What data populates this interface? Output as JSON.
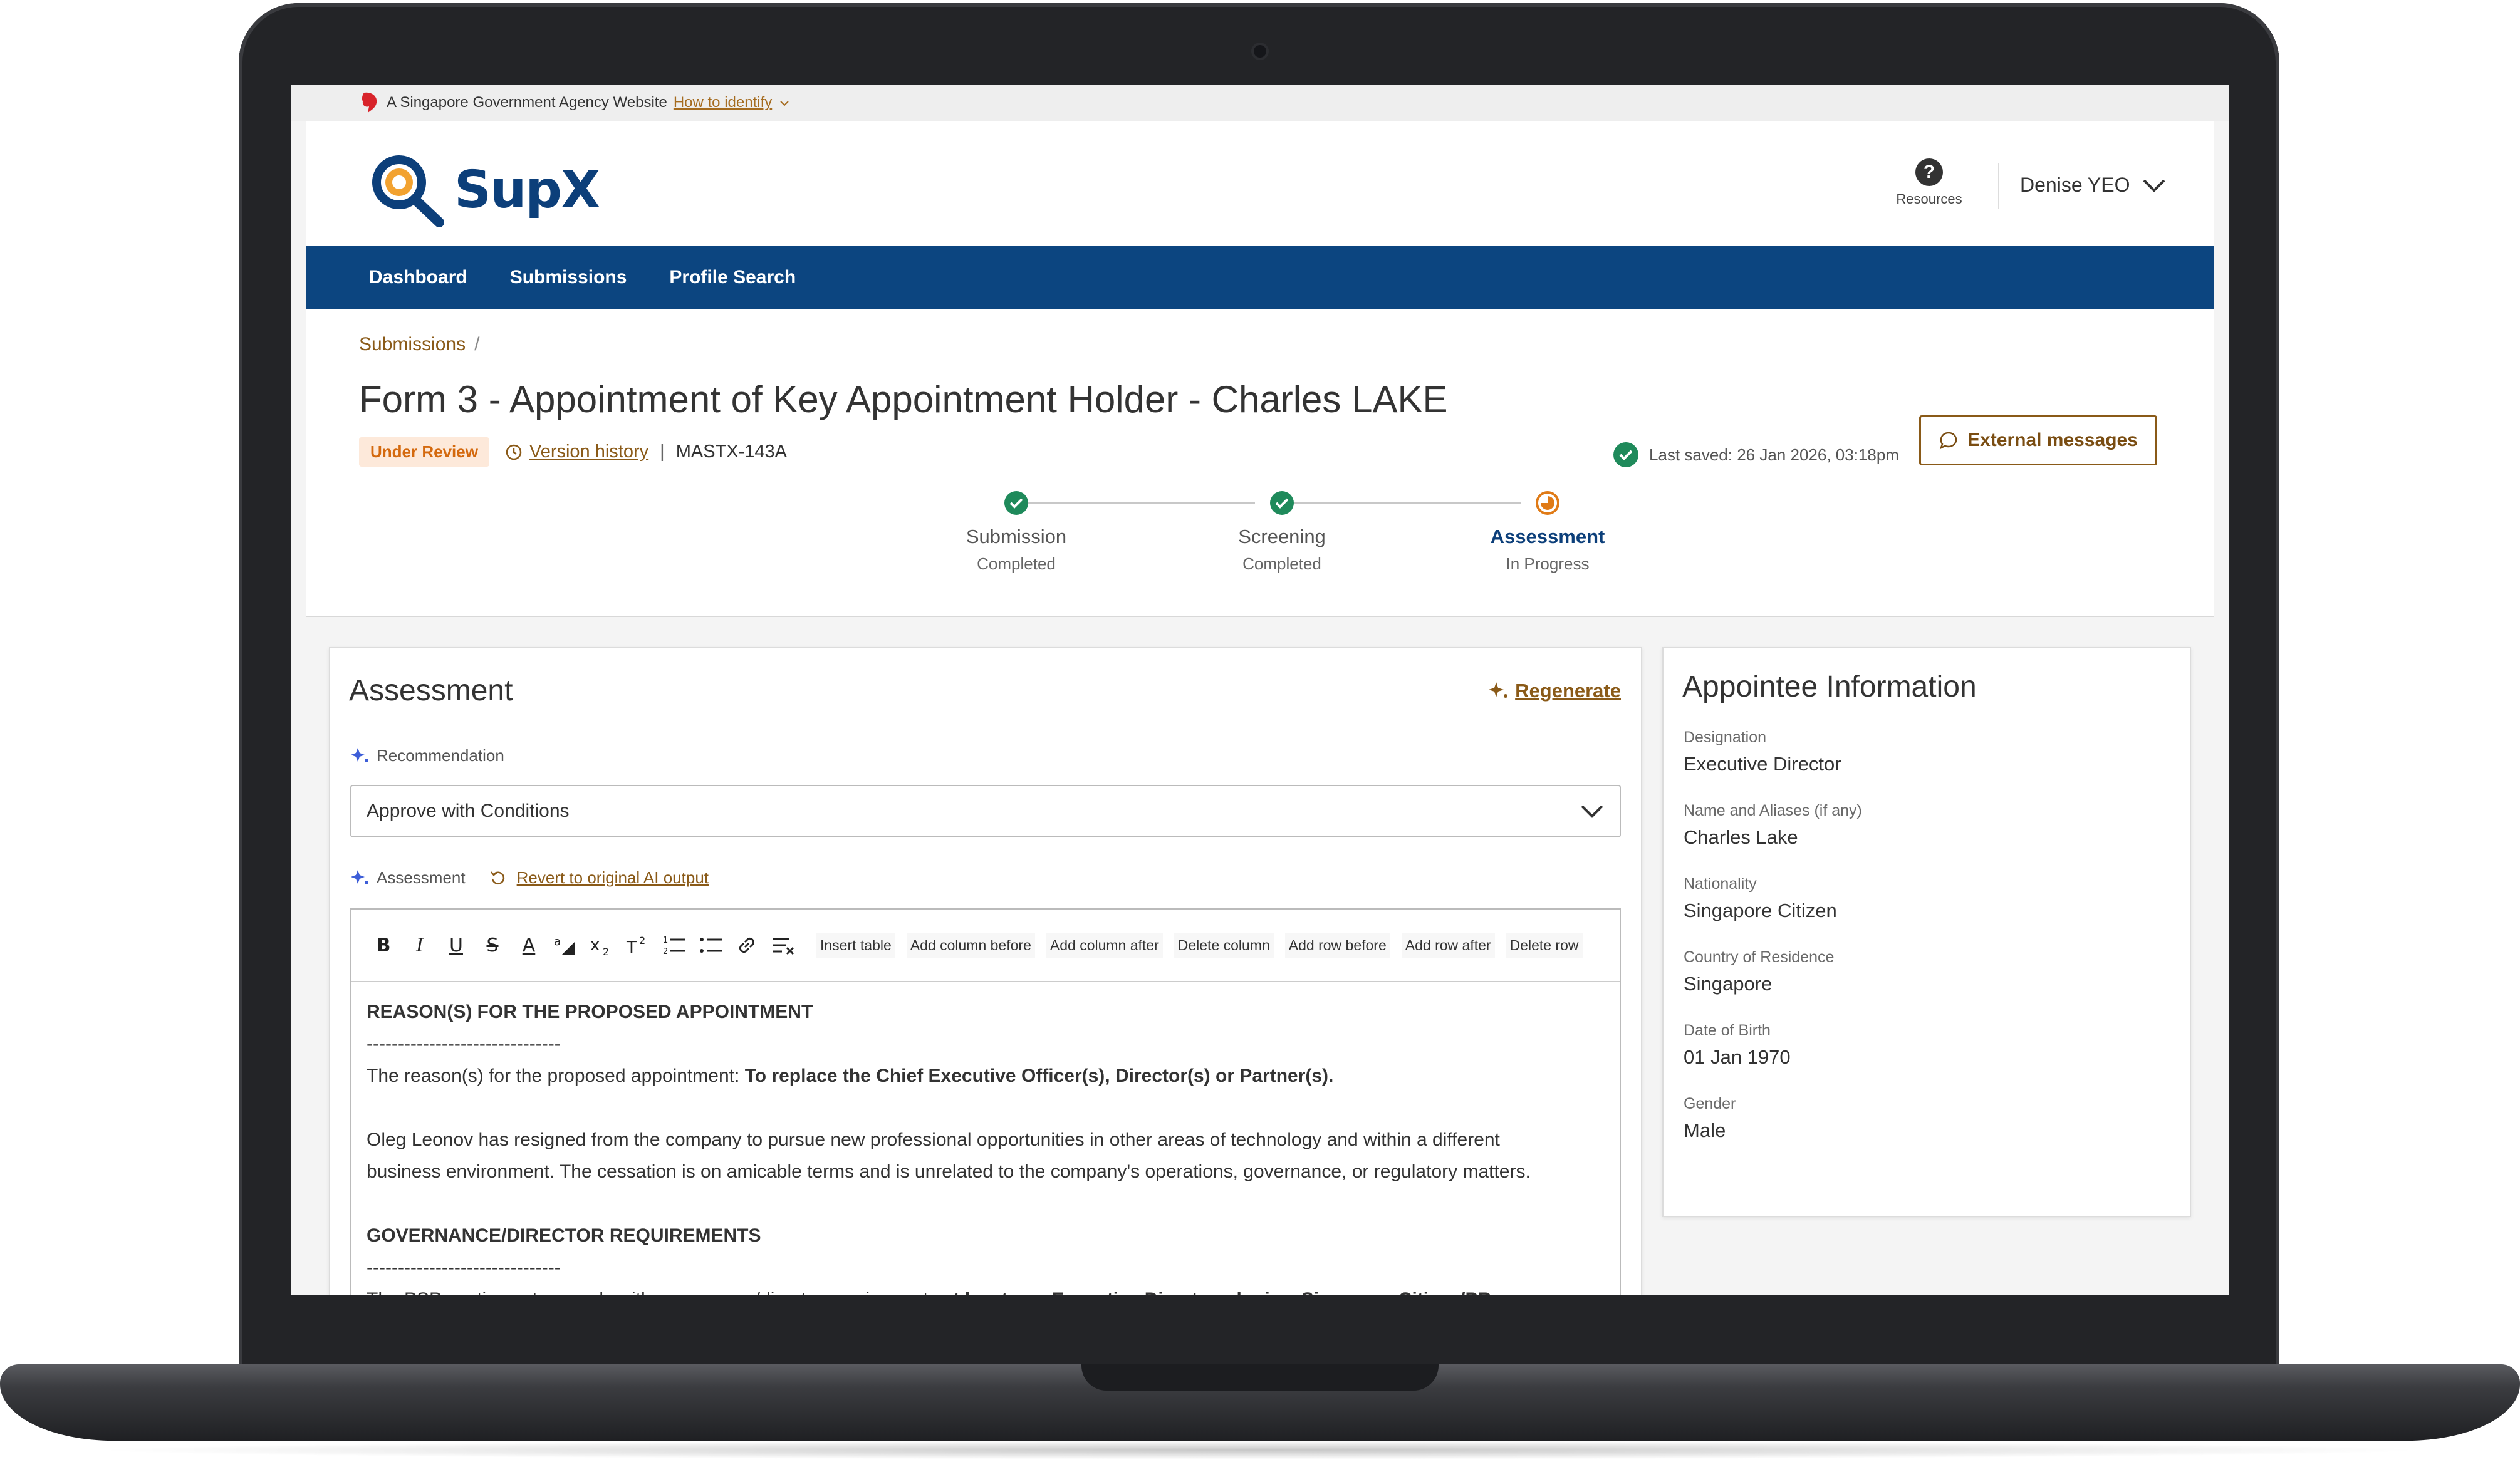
{
  "gov_banner": {
    "label": "A Singapore Government Agency Website",
    "link": "How to identify"
  },
  "header": {
    "logo_text": "SupX",
    "resources_label": "Resources",
    "user_name": "Denise YEO"
  },
  "nav": {
    "items": [
      "Dashboard",
      "Submissions",
      "Profile Search"
    ]
  },
  "page": {
    "breadcrumb": "Submissions",
    "breadcrumb_sep": "/",
    "title": "Form 3 - Appointment of Key Appointment Holder - Charles LAKE",
    "status_badge": "Under Review",
    "version_history": "Version history",
    "meta_sep": "|",
    "reference": "MASTX-143A",
    "last_saved": "Last saved: 26 Jan 2026, 03:18pm",
    "external_messages": "External messages"
  },
  "steps": [
    {
      "label": "Submission",
      "status": "Completed"
    },
    {
      "label": "Screening",
      "status": "Completed"
    },
    {
      "label": "Assessment",
      "status": "In Progress"
    }
  ],
  "assessment": {
    "title": "Assessment",
    "regenerate": "Regenerate",
    "recommendation_label": "Recommendation",
    "recommendation_value": "Approve with Conditions",
    "assessment_label": "Assessment",
    "revert_label": "Revert to original AI output",
    "toolbar_actions": [
      "Insert table",
      "Add column before",
      "Add column after",
      "Delete column",
      "Add row before",
      "Add row after",
      "Delete row"
    ],
    "body": {
      "heading1": "REASON(S) FOR THE PROPOSED APPOINTMENT",
      "rule1": "-------------------------------",
      "reason_prefix": "The reason(s) for the proposed appointment: ",
      "reason_bold": "To replace the Chief Executive Officer(s), Director(s) or Partner(s).",
      "para1_line1": "Oleg Leonov has resigned from the company to pursue new professional opportunities in other areas of technology and within a different",
      "para1_line2": "business environment. The cessation is on amicable terms and is unrelated to the company's operations, governance, or regulatory matters.",
      "heading2": "GOVERNANCE/DIRECTOR REQUIREMENTS",
      "rule2": "-------------------------------",
      "para2_start": "The PSP continues to comply with governance/director requirements ",
      "para2_bold": "at least one Executive Director who is a Singapore Citizen/PR"
    }
  },
  "appointee": {
    "title": "Appointee Information",
    "fields": [
      {
        "label": "Designation",
        "value": "Executive Director"
      },
      {
        "label": "Name and Aliases (if any)",
        "value": "Charles Lake"
      },
      {
        "label": "Nationality",
        "value": "Singapore Citizen"
      },
      {
        "label": "Country of Residence",
        "value": "Singapore"
      },
      {
        "label": "Date of Birth",
        "value": "01 Jan 1970"
      },
      {
        "label": "Gender",
        "value": "Male"
      }
    ]
  },
  "colors": {
    "brand_blue": "#0c4580",
    "accent_gold": "#8a5a18",
    "success_green": "#1f8a5b",
    "in_progress_orange": "#e07b17",
    "badge_bg": "#fde9da"
  }
}
